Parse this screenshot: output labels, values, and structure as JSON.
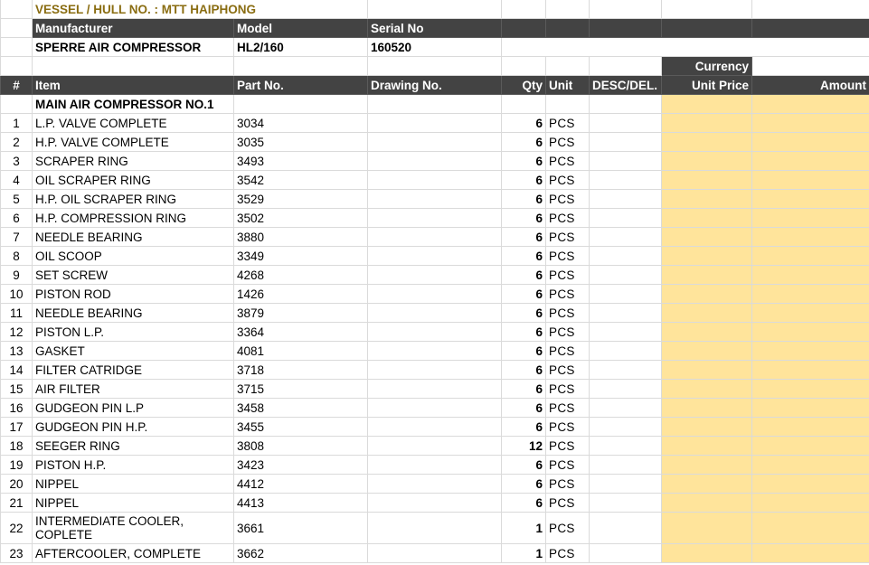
{
  "vessel": "VESSEL / HULL NO. : MTT HAIPHONG",
  "equipment_headers": {
    "manufacturer": "Manufacturer",
    "model": "Model",
    "serial": "Serial No"
  },
  "equipment": {
    "manufacturer": "SPERRE AIR COMPRESSOR",
    "model": "HL2/160",
    "serial": "160520"
  },
  "currency_label": "Currency",
  "columns": {
    "num": "#",
    "item": "Item",
    "part": "Part No.",
    "drawing": "Drawing No.",
    "qty": "Qty",
    "unit": "Unit",
    "desc": "DESC/DEL.",
    "unit_price": "Unit Price",
    "amount": "Amount"
  },
  "section_title": "MAIN AIR COMPRESSOR NO.1",
  "rows": [
    {
      "n": "1",
      "item": "L.P. VALVE COMPLETE",
      "part": "3034",
      "qty": "6",
      "unit": "PCS"
    },
    {
      "n": "2",
      "item": "H.P. VALVE COMPLETE",
      "part": "3035",
      "qty": "6",
      "unit": "PCS"
    },
    {
      "n": "3",
      "item": "SCRAPER RING",
      "part": "3493",
      "qty": "6",
      "unit": "PCS"
    },
    {
      "n": "4",
      "item": "OIL SCRAPER RING",
      "part": "3542",
      "qty": "6",
      "unit": "PCS"
    },
    {
      "n": "5",
      "item": "H.P. OIL SCRAPER RING",
      "part": "3529",
      "qty": "6",
      "unit": "PCS"
    },
    {
      "n": "6",
      "item": "H.P. COMPRESSION RING",
      "part": "3502",
      "qty": "6",
      "unit": "PCS"
    },
    {
      "n": "7",
      "item": "NEEDLE BEARING",
      "part": "3880",
      "qty": "6",
      "unit": "PCS"
    },
    {
      "n": "8",
      "item": "OIL SCOOP",
      "part": "3349",
      "qty": "6",
      "unit": "PCS"
    },
    {
      "n": "9",
      "item": "SET SCREW",
      "part": "4268",
      "qty": "6",
      "unit": "PCS"
    },
    {
      "n": "10",
      "item": "PISTON ROD",
      "part": "1426",
      "qty": "6",
      "unit": "PCS"
    },
    {
      "n": "11",
      "item": "NEEDLE BEARING",
      "part": "3879",
      "qty": "6",
      "unit": "PCS"
    },
    {
      "n": "12",
      "item": "PISTON L.P.",
      "part": "3364",
      "qty": "6",
      "unit": "PCS"
    },
    {
      "n": "13",
      "item": "GASKET",
      "part": "4081",
      "qty": "6",
      "unit": "PCS"
    },
    {
      "n": "14",
      "item": "FILTER CATRIDGE",
      "part": "3718",
      "qty": "6",
      "unit": "PCS"
    },
    {
      "n": "15",
      "item": "AIR FILTER",
      "part": "3715",
      "qty": "6",
      "unit": "PCS"
    },
    {
      "n": "16",
      "item": "GUDGEON PIN L.P",
      "part": "3458",
      "qty": "6",
      "unit": "PCS"
    },
    {
      "n": "17",
      "item": "GUDGEON PIN H.P.",
      "part": "3455",
      "qty": "6",
      "unit": "PCS"
    },
    {
      "n": "18",
      "item": "SEEGER RING",
      "part": "3808",
      "qty": "12",
      "unit": "PCS"
    },
    {
      "n": "19",
      "item": "PISTON H.P.",
      "part": "3423",
      "qty": "6",
      "unit": "PCS"
    },
    {
      "n": "20",
      "item": "NIPPEL",
      "part": "4412",
      "qty": "6",
      "unit": "PCS"
    },
    {
      "n": "21",
      "item": "NIPPEL",
      "part": "4413",
      "qty": "6",
      "unit": "PCS"
    },
    {
      "n": "22",
      "item": "INTERMEDIATE COOLER, COPLETE",
      "part": "3661",
      "qty": "1",
      "unit": "PCS"
    },
    {
      "n": "23",
      "item": "AFTERCOOLER, COMPLETE",
      "part": "3662",
      "qty": "1",
      "unit": "PCS"
    }
  ],
  "colors": {
    "header_bg": "#434343",
    "vessel_text": "#8a6d12",
    "price_fill": "#ffe49b"
  }
}
